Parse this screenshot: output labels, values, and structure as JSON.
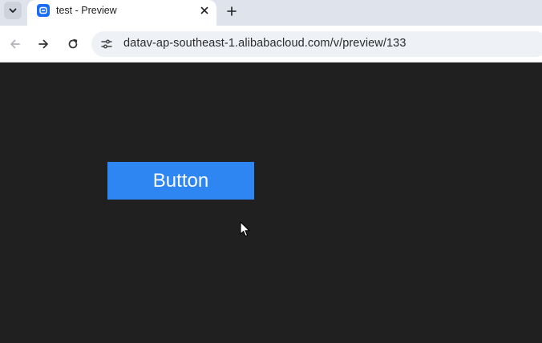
{
  "browser": {
    "tab": {
      "title": "test - Preview"
    },
    "address_bar": {
      "url": "datav-ap-southeast-1.alibabacloud.com/v/preview/133"
    },
    "icons": {
      "tab_search": "chevron-down-icon",
      "favicon": "datav-logo-icon",
      "tab_close": "close-icon",
      "new_tab": "plus-icon",
      "back": "arrow-left-icon",
      "forward": "arrow-right-icon",
      "reload": "reload-icon",
      "site_info": "tune-icon"
    }
  },
  "page": {
    "button": {
      "label": "Button",
      "color": "#2d86f2"
    },
    "background": "#202020"
  }
}
